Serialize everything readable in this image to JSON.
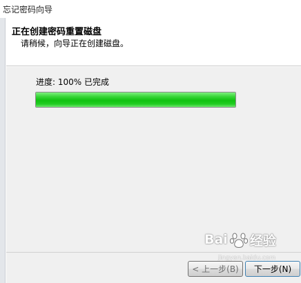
{
  "window": {
    "title": "忘记密码向导"
  },
  "header": {
    "heading": "正在创建密码重置磁盘",
    "subheading": "请稍候，向导正在创建磁盘。"
  },
  "progress": {
    "label": "进度: 100% 已完成",
    "percent": 100,
    "fill_color": "#11c211"
  },
  "buttons": {
    "back_label": "< 上一步(B)",
    "next_label": "下一步(N)"
  },
  "watermark": {
    "brand_prefix": "Bai",
    "brand_suffix": "经验",
    "site": "jingyan.baidu.com"
  }
}
